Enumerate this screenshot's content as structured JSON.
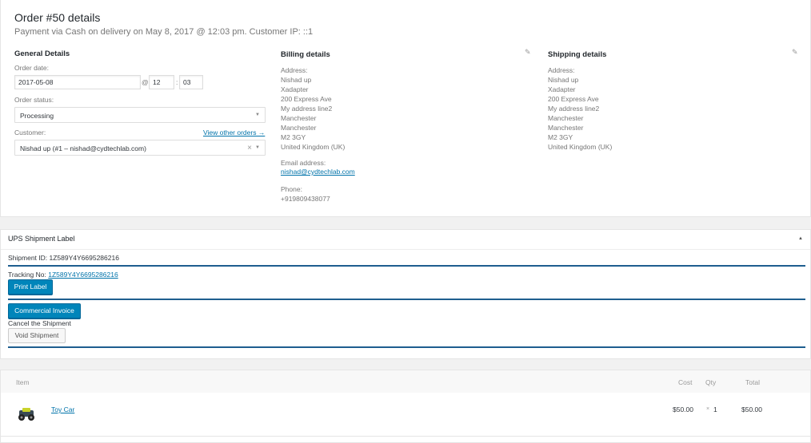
{
  "order": {
    "title": "Order #50 details",
    "subtitle": "Payment via Cash on delivery on May 8, 2017 @ 12:03 pm. Customer IP: ::1"
  },
  "general": {
    "heading": "General Details",
    "date_label": "Order date:",
    "date_value": "2017-05-08",
    "at_sign": "@",
    "hour": "12",
    "colon": ":",
    "minute": "03",
    "status_label": "Order status:",
    "status_value": "Processing",
    "customer_label": "Customer:",
    "view_orders_link": "View other orders →",
    "customer_value": "Nishad up (#1 – nishad@cydtechlab.com)",
    "clear_symbol": "×"
  },
  "billing": {
    "heading": "Billing details",
    "address_label": "Address:",
    "address_lines": [
      "Nishad up",
      "Xadapter",
      "200 Express Ave",
      "My address line2",
      "Manchester",
      "Manchester",
      "M2 3GY",
      "United Kingdom (UK)"
    ],
    "email_label": "Email address:",
    "email": "nishad@cydtechlab.com",
    "phone_label": "Phone:",
    "phone": "+919809438077"
  },
  "shipping": {
    "heading": "Shipping details",
    "address_label": "Address:",
    "address_lines": [
      "Nishad up",
      "Xadapter",
      "200 Express Ave",
      "My address line2",
      "Manchester",
      "Manchester",
      "M2 3GY",
      "United Kingdom (UK)"
    ]
  },
  "icons": {
    "edit": "pencil-icon",
    "toggle": "triangle-up-icon",
    "dropdown": "chevron-down-icon"
  },
  "ups": {
    "heading": "UPS Shipment Label",
    "toggle_symbol": "▲",
    "shipment_id_text": "Shipment ID: 1Z589Y4Y6695286216",
    "tracking_label": "Tracking No: ",
    "tracking_number": "1Z589Y4Y6695286216",
    "print_label": "Print Label",
    "commercial_invoice": "Commercial Invoice",
    "cancel_text": "Cancel the Shipment",
    "void_button": "Void Shipment"
  },
  "items": {
    "headers": {
      "item": "Item",
      "cost": "Cost",
      "qty": "Qty",
      "total": "Total"
    },
    "rows": [
      {
        "name": "Toy Car",
        "cost": "$50.00",
        "qty_x": "×",
        "qty": "1",
        "total": "$50.00"
      }
    ]
  },
  "colors": {
    "accent": "#0085ba",
    "link": "#0073aa",
    "divider": "#1e5e8f"
  }
}
